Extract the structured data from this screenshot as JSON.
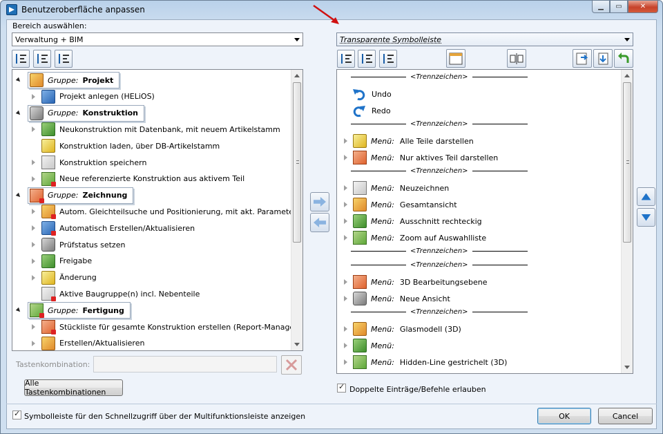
{
  "window": {
    "title": "Benutzeroberfläche anpassen"
  },
  "left": {
    "area_label": "Bereich auswählen:",
    "area_value": "Verwaltung + BIM",
    "tree": [
      {
        "type": "group",
        "prefix": "Gruppe:",
        "name": "Projekt",
        "icon": "project-group-icon"
      },
      {
        "type": "item",
        "label": "Projekt anlegen (HELiOS)",
        "icon": "project-create-icon",
        "expand": true
      },
      {
        "type": "group",
        "prefix": "Gruppe:",
        "name": "Konstruktion",
        "icon": "construction-group-icon"
      },
      {
        "type": "item",
        "label": "Neukonstruktion mit Datenbank, mit neuem Artikelstamm",
        "icon": "new-construction-icon",
        "expand": true
      },
      {
        "type": "item",
        "label": "Konstruktion laden, über DB-Artikelstamm",
        "icon": "load-construction-icon",
        "expand": false
      },
      {
        "type": "item",
        "label": "Konstruktion speichern",
        "icon": "save-icon",
        "expand": true
      },
      {
        "type": "item",
        "label": "Neue referenzierte Konstruktion aus aktivem Teil",
        "icon": "referenced-construction-icon",
        "expand": true
      },
      {
        "type": "group",
        "prefix": "Gruppe:",
        "name": "Zeichnung",
        "icon": "drawing-group-icon"
      },
      {
        "type": "item",
        "label": "Autom. Gleichteilsuche und Positionierung, mit akt. Parametern",
        "icon": "identical-parts-icon",
        "expand": true
      },
      {
        "type": "item",
        "label": "Automatisch Erstellen/Aktualisieren",
        "icon": "auto-update-icon",
        "expand": true
      },
      {
        "type": "item",
        "label": "Prüfstatus setzen",
        "icon": "check-status-icon",
        "expand": true
      },
      {
        "type": "item",
        "label": "Freigabe",
        "icon": "release-icon",
        "expand": true
      },
      {
        "type": "item",
        "label": "Änderung",
        "icon": "change-icon",
        "expand": true
      },
      {
        "type": "item",
        "label": "Aktive Baugruppe(n) incl. Nebenteile",
        "icon": "assembly-icon",
        "expand": false
      },
      {
        "type": "group",
        "prefix": "Gruppe:",
        "name": "Fertigung",
        "icon": "production-group-icon"
      },
      {
        "type": "item",
        "label": "Stückliste für gesamte Konstruktion erstellen (Report-Manager)",
        "icon": "bom-icon",
        "expand": true
      },
      {
        "type": "item",
        "label": "Erstellen/Aktualisieren",
        "icon": "create-update-icon",
        "expand": true
      }
    ],
    "shortcut_label": "Tastenkombination:",
    "shortcut_value": "",
    "all_shortcuts_button": "Alle Tastenkombinationen"
  },
  "right": {
    "toolbar_value": "Transparente Symbolleiste",
    "separator_text": "<Trennzeichen>",
    "list": [
      {
        "type": "sep"
      },
      {
        "type": "cmd",
        "label": "Undo",
        "icon": "undo-icon"
      },
      {
        "type": "cmd",
        "label": "Redo",
        "icon": "redo-icon"
      },
      {
        "type": "sep"
      },
      {
        "type": "menu",
        "prefix": "Menü:",
        "label": "Alle Teile darstellen",
        "icon": "show-all-parts-icon"
      },
      {
        "type": "menu",
        "prefix": "Menü:",
        "label": "Nur aktives Teil darstellen",
        "icon": "show-active-part-icon"
      },
      {
        "type": "sep"
      },
      {
        "type": "menu",
        "prefix": "Menü:",
        "label": "Neuzeichnen",
        "icon": "redraw-icon"
      },
      {
        "type": "menu",
        "prefix": "Menü:",
        "label": "Gesamtansicht",
        "icon": "zoom-all-icon"
      },
      {
        "type": "menu",
        "prefix": "Menü:",
        "label": "Ausschnitt rechteckig",
        "icon": "zoom-rect-icon"
      },
      {
        "type": "menu",
        "prefix": "Menü:",
        "label": "Zoom auf Auswahlliste",
        "icon": "zoom-selection-icon"
      },
      {
        "type": "sep"
      },
      {
        "type": "sep"
      },
      {
        "type": "menu",
        "prefix": "Menü:",
        "label": "3D Bearbeitungsebene",
        "icon": "work-plane-icon"
      },
      {
        "type": "menu",
        "prefix": "Menü:",
        "label": "Neue Ansicht",
        "icon": "new-view-icon"
      },
      {
        "type": "sep"
      },
      {
        "type": "menu",
        "prefix": "Menü:",
        "label": "Glasmodell (3D)",
        "icon": "glass-model-icon"
      },
      {
        "type": "menu",
        "prefix": "Menü:",
        "label": "",
        "icon": "wireframe-icon"
      },
      {
        "type": "menu",
        "prefix": "Menü:",
        "label": "Hidden-Line gestrichelt (3D)",
        "icon": "hidden-line-icon"
      }
    ],
    "allow_duplicates_label": "Doppelte Einträge/Befehle erlauben"
  },
  "footer": {
    "quick_access_label": "Symbolleiste für den Schnellzugriff über der Multifunktionsleiste anzeigen",
    "ok": "OK",
    "cancel": "Cancel"
  }
}
